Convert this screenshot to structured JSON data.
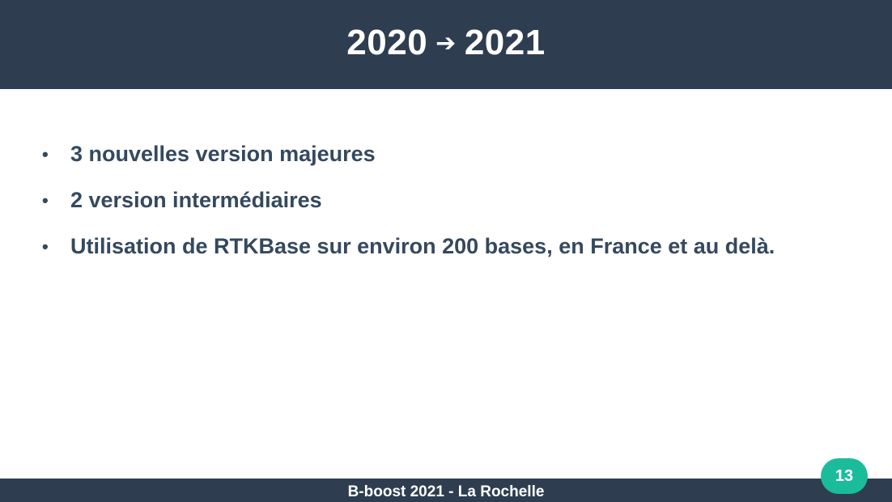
{
  "title": {
    "from_year": "2020",
    "arrow": "➔",
    "to_year": "2021"
  },
  "bullets": [
    {
      "marker": "•",
      "text": "3 nouvelles version majeures"
    },
    {
      "marker": "•",
      "text": "2 version intermédiaires"
    },
    {
      "marker": "•",
      "text": "Utilisation de RTKBase sur environ 200 bases, en France et au delà."
    }
  ],
  "footer": {
    "text": "B-boost 2021 - La Rochelle"
  },
  "page_number": "13",
  "colors": {
    "header_background": "#2e3e50",
    "text": "#34495e",
    "badge": "#1abc9c"
  }
}
